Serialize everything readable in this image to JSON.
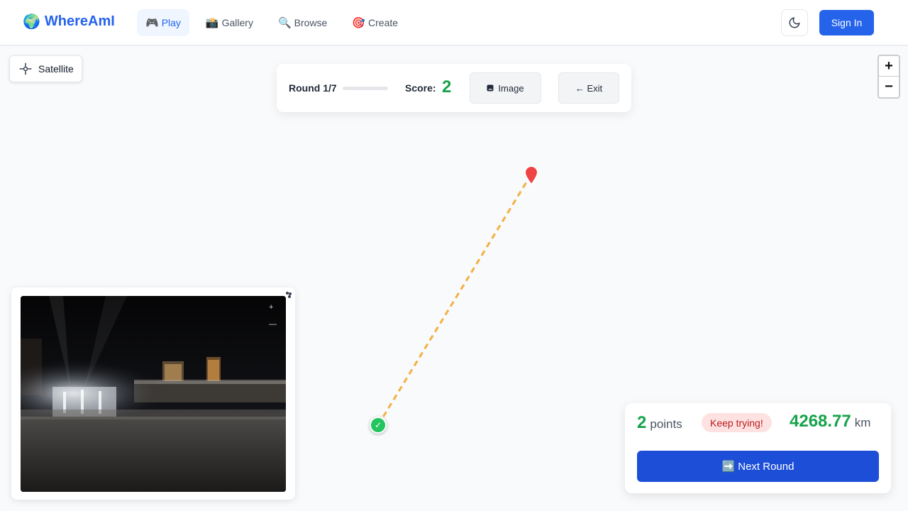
{
  "header": {
    "logo_icon": "globe-emoji",
    "app_name": "WhereAmI",
    "nav": [
      {
        "icon": "🎮",
        "label": "Play",
        "active": true
      },
      {
        "icon": "📸",
        "label": "Gallery",
        "active": false
      },
      {
        "icon": "🔍",
        "label": "Browse",
        "active": false
      },
      {
        "icon": "🎯",
        "label": "Create",
        "active": false
      }
    ],
    "theme_icon": "moon-icon",
    "signin_label": "Sign In"
  },
  "map": {
    "satellite_label": "Satellite",
    "zoom_in": "+",
    "zoom_out": "−"
  },
  "round_panel": {
    "round_label": "Round 1/7",
    "progress_fraction": 0.0,
    "score_label": "Score:",
    "score_value": "2",
    "image_button": "Image",
    "exit_button": "← Exit"
  },
  "photo_panel": {
    "zoom_in": "+",
    "zoom_out": "—"
  },
  "result": {
    "points_value": "2",
    "points_unit": "points",
    "feedback": "Keep trying!",
    "distance_value": "4268.77",
    "distance_unit": "km",
    "next_button": "Next Round",
    "next_icon": "➡️"
  },
  "colors": {
    "accent": "#2563eb",
    "success": "#16a34a",
    "route": "#f5b041",
    "guess_pin": "#ef4444"
  }
}
